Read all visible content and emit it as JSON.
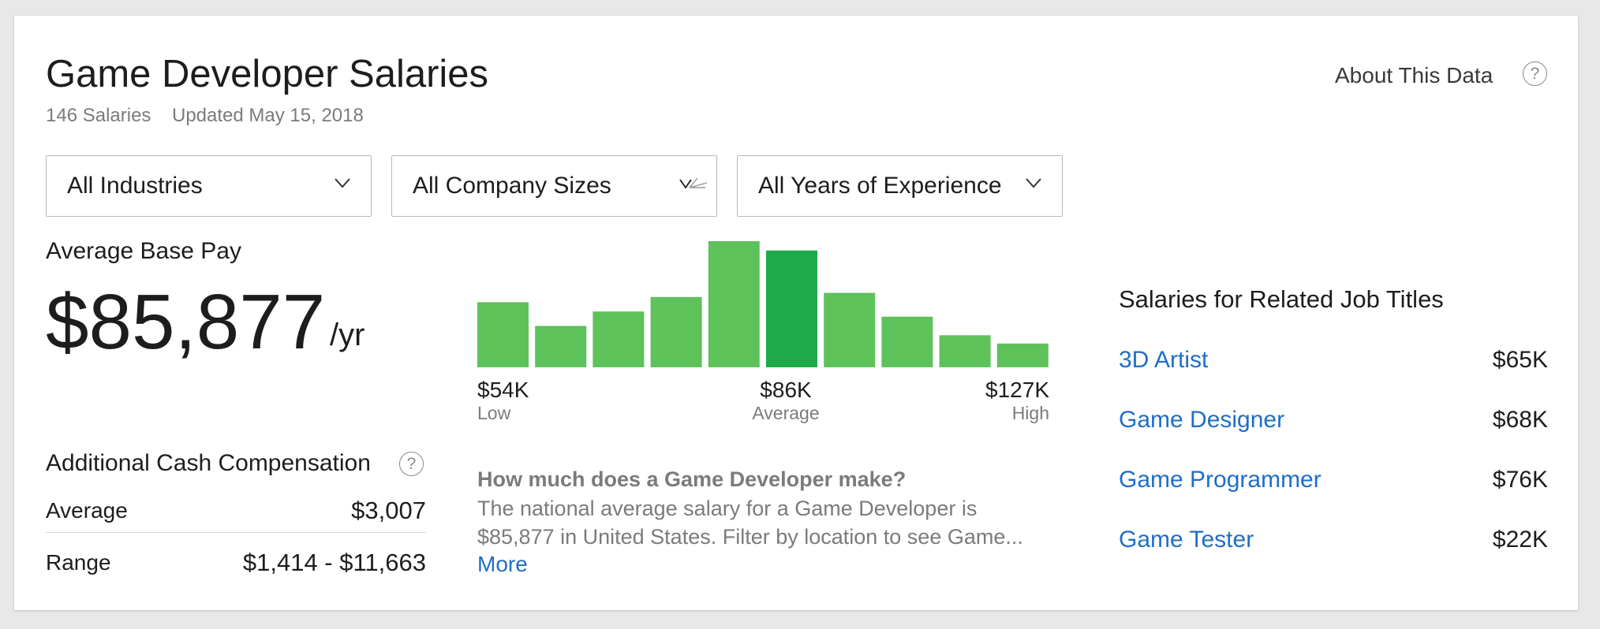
{
  "header": {
    "title": "Game Developer Salaries",
    "salary_count": "146 Salaries",
    "updated": "Updated May 15, 2018",
    "about_link": "About This Data",
    "help_glyph": "?"
  },
  "filters": [
    {
      "label": "All Industries"
    },
    {
      "label": "All Company Sizes"
    },
    {
      "label": "All Years of Experience"
    }
  ],
  "base_pay": {
    "heading": "Average Base Pay",
    "amount": "$85,877",
    "unit": "/yr"
  },
  "chart_data": {
    "type": "bar",
    "values": [
      63,
      40,
      54,
      68,
      122,
      113,
      72,
      49,
      31,
      23
    ],
    "highlight_index": 5,
    "labels": [
      {
        "value": "$54K",
        "caption": "Low"
      },
      {
        "value": "$86K",
        "caption": "Average"
      },
      {
        "value": "$127K",
        "caption": "High"
      }
    ],
    "colors": {
      "bar": "#5ec25a",
      "highlight": "#1ea94a"
    }
  },
  "additional_cash": {
    "heading": "Additional Cash Compensation",
    "help_glyph": "?",
    "rows": [
      {
        "label": "Average",
        "value": "$3,007"
      },
      {
        "label": "Range",
        "value": "$1,414 - $11,663"
      }
    ]
  },
  "description": {
    "question": "How much does a Game Developer make?",
    "text": "The national average salary for a Game Developer is $85,877 in United States. Filter by location to see Game...",
    "more_link": "More"
  },
  "related": {
    "heading": "Salaries for Related Job Titles",
    "items": [
      {
        "title": "3D Artist",
        "salary": "$65K"
      },
      {
        "title": "Game Designer",
        "salary": "$68K"
      },
      {
        "title": "Game Programmer",
        "salary": "$76K"
      },
      {
        "title": "Game Tester",
        "salary": "$22K"
      }
    ]
  },
  "colors": {
    "link": "#1f6ec7",
    "muted": "#7b7b7b",
    "text": "#1d1d1d"
  }
}
